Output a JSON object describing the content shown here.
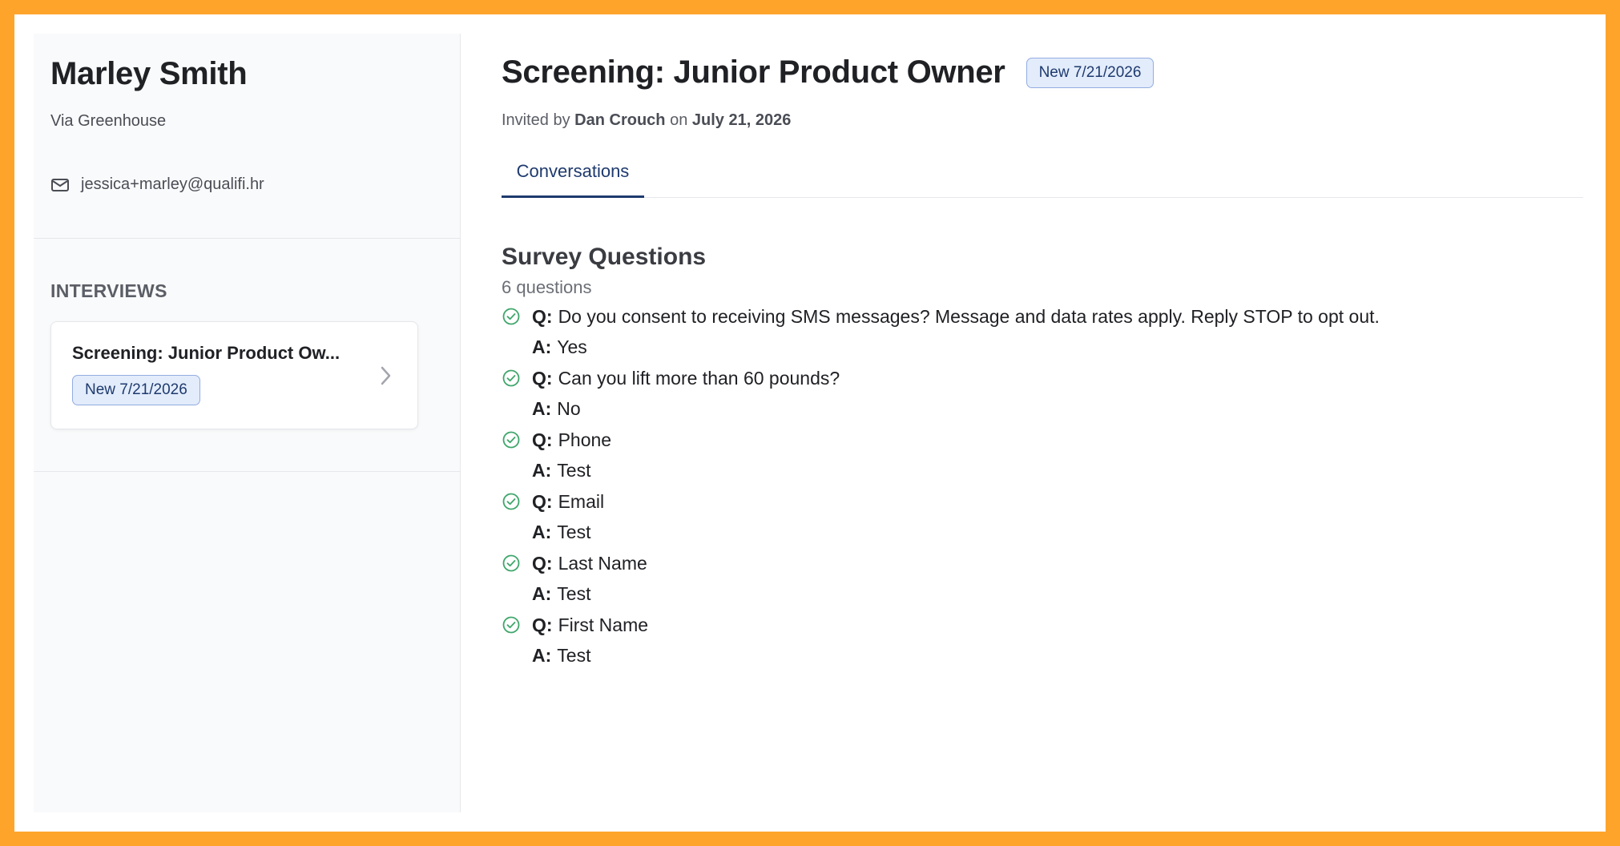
{
  "candidate": {
    "name": "Marley Smith",
    "source": "Via Greenhouse",
    "email": "jessica+marley@qualifi.hr"
  },
  "interviews": {
    "label": "INTERVIEWS",
    "items": [
      {
        "title": "Screening: Junior Product Ow...",
        "badge": "New 7/21/2026"
      }
    ]
  },
  "header": {
    "title": "Screening: Junior Product Owner",
    "badge": "New 7/21/2026",
    "invited_prefix": "Invited by",
    "invited_by": "Dan Crouch",
    "invited_on_word": "on",
    "invited_date": "July 21, 2026"
  },
  "tabs": [
    {
      "label": "Conversations",
      "active": true
    }
  ],
  "survey": {
    "title": "Survey Questions",
    "count": "6 questions",
    "q_label": "Q:",
    "a_label": "A:",
    "items": [
      {
        "q": "Do you consent to receiving SMS messages? Message and data rates apply. Reply STOP to opt out.",
        "a": "Yes"
      },
      {
        "q": "Can you lift more than 60 pounds?",
        "a": "No"
      },
      {
        "q": "Phone",
        "a": "Test"
      },
      {
        "q": "Email",
        "a": "Test"
      },
      {
        "q": "Last Name",
        "a": "Test"
      },
      {
        "q": "First Name",
        "a": "Test"
      }
    ]
  },
  "colors": {
    "frame_border": "#FFA42B",
    "accent": "#1E3A6E",
    "badge_bg": "#E3ECFB",
    "check_green": "#3FA66B"
  }
}
